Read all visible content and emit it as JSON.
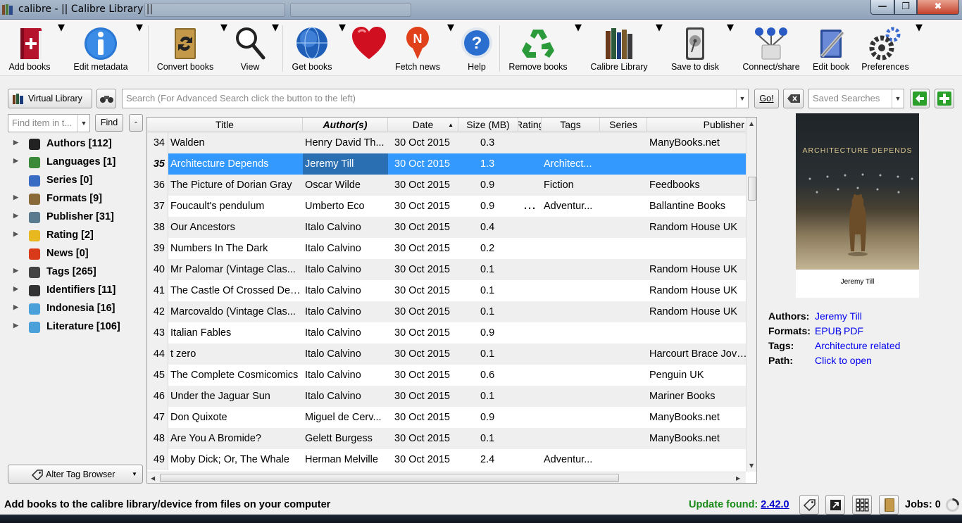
{
  "window": {
    "title": "calibre - || Calibre Library ||",
    "minimize_label": "—",
    "maximize_label": "❐",
    "close_label": "✖"
  },
  "toolbar": {
    "items": [
      {
        "label": "Add books",
        "icon": "add-book-icon"
      },
      {
        "label": "Edit metadata",
        "icon": "info-icon"
      },
      {
        "label": "Convert books",
        "icon": "convert-icon"
      },
      {
        "label": "View",
        "icon": "magnifier-icon"
      },
      {
        "label": "Get books",
        "icon": "globe-icon"
      },
      {
        "label": "Donate",
        "icon": "heart-icon"
      },
      {
        "label": "Fetch news",
        "icon": "news-icon"
      },
      {
        "label": "Help",
        "icon": "help-icon"
      },
      {
        "label": "Remove books",
        "icon": "recycle-icon"
      },
      {
        "label": "Calibre Library",
        "icon": "library-icon"
      },
      {
        "label": "Save to disk",
        "icon": "disk-icon"
      },
      {
        "label": "Connect/share",
        "icon": "network-icon"
      },
      {
        "label": "Edit book",
        "icon": "edit-book-icon"
      },
      {
        "label": "Preferences",
        "icon": "gear-icon"
      }
    ]
  },
  "search": {
    "virtual_library_label": "Virtual Library",
    "placeholder": "Search (For Advanced Search click the button to the left)",
    "go_label": "Go!",
    "saved_searches_placeholder": "Saved Searches"
  },
  "tag_browser": {
    "find_placeholder": "Find item in t...",
    "find_label": "Find",
    "collapse_label": "-",
    "alter_label": "Alter Tag Browser",
    "items": [
      {
        "label": "Authors [112]",
        "expandable": true,
        "icon": "person-icon",
        "color": "#222222"
      },
      {
        "label": "Languages [1]",
        "expandable": true,
        "icon": "languages-icon",
        "color": "#3a8a3a"
      },
      {
        "label": "Series [0]",
        "expandable": false,
        "icon": "series-icon",
        "color": "#3a6bc4"
      },
      {
        "label": "Formats [9]",
        "expandable": true,
        "icon": "book-icon",
        "color": "#8b6a3a"
      },
      {
        "label": "Publisher [31]",
        "expandable": true,
        "icon": "publisher-icon",
        "color": "#5a7a90"
      },
      {
        "label": "Rating [2]",
        "expandable": true,
        "icon": "star-icon",
        "color": "#e8b820"
      },
      {
        "label": "News [0]",
        "expandable": false,
        "icon": "news-icon",
        "color": "#d83a1a"
      },
      {
        "label": "Tags [265]",
        "expandable": true,
        "icon": "tag-icon",
        "color": "#444444"
      },
      {
        "label": "Identifiers [11]",
        "expandable": true,
        "icon": "barcode-icon",
        "color": "#333333"
      },
      {
        "label": "Indonesia [16]",
        "expandable": true,
        "icon": "folder-plus-icon",
        "color": "#4aa0d8"
      },
      {
        "label": "Literature [106]",
        "expandable": true,
        "icon": "folder-plus-icon",
        "color": "#4aa0d8"
      }
    ]
  },
  "table": {
    "columns": [
      "Title",
      "Author(s)",
      "Date",
      "Size (MB)",
      "Rating",
      "Tags",
      "Series",
      "Publisher"
    ],
    "rows": [
      {
        "num": "34",
        "title": "Walden",
        "author": "Henry David Th...",
        "date": "30 Oct 2015",
        "size": "0.3",
        "rating": "",
        "tags": "",
        "publisher": "ManyBooks.net"
      },
      {
        "num": "35",
        "title": "Architecture Depends",
        "author": "Jeremy Till",
        "date": "30 Oct 2015",
        "size": "1.3",
        "rating": "",
        "tags": "Architect...",
        "publisher": ""
      },
      {
        "num": "36",
        "title": "The Picture of Dorian Gray",
        "author": "Oscar Wilde",
        "date": "30 Oct 2015",
        "size": "0.9",
        "rating": "",
        "tags": "Fiction",
        "publisher": "Feedbooks"
      },
      {
        "num": "37",
        "title": "Foucault's pendulum",
        "author": "Umberto Eco",
        "date": "30 Oct 2015",
        "size": "0.9",
        "rating": "...",
        "tags": "Adventur...",
        "publisher": "Ballantine Books"
      },
      {
        "num": "38",
        "title": "Our Ancestors",
        "author": "Italo Calvino",
        "date": "30 Oct 2015",
        "size": "0.4",
        "rating": "",
        "tags": "",
        "publisher": "Random House UK"
      },
      {
        "num": "39",
        "title": "Numbers In The Dark",
        "author": "Italo Calvino",
        "date": "30 Oct 2015",
        "size": "0.2",
        "rating": "",
        "tags": "",
        "publisher": ""
      },
      {
        "num": "40",
        "title": "Mr Palomar (Vintage Clas...",
        "author": "Italo Calvino",
        "date": "30 Oct 2015",
        "size": "0.1",
        "rating": "",
        "tags": "",
        "publisher": "Random House UK"
      },
      {
        "num": "41",
        "title": "The Castle Of Crossed Des...",
        "author": "Italo Calvino",
        "date": "30 Oct 2015",
        "size": "0.1",
        "rating": "",
        "tags": "",
        "publisher": "Random House UK"
      },
      {
        "num": "42",
        "title": "Marcovaldo (Vintage Clas...",
        "author": "Italo Calvino",
        "date": "30 Oct 2015",
        "size": "0.1",
        "rating": "",
        "tags": "",
        "publisher": "Random House UK"
      },
      {
        "num": "43",
        "title": "Italian Fables",
        "author": "Italo Calvino",
        "date": "30 Oct 2015",
        "size": "0.9",
        "rating": "",
        "tags": "",
        "publisher": ""
      },
      {
        "num": "44",
        "title": "t zero",
        "author": "Italo Calvino",
        "date": "30 Oct 2015",
        "size": "0.1",
        "rating": "",
        "tags": "",
        "publisher": "Harcourt Brace Jovan"
      },
      {
        "num": "45",
        "title": "The Complete Cosmicomics",
        "author": "Italo Calvino",
        "date": "30 Oct 2015",
        "size": "0.6",
        "rating": "",
        "tags": "",
        "publisher": "Penguin UK"
      },
      {
        "num": "46",
        "title": "Under the Jaguar Sun",
        "author": "Italo Calvino",
        "date": "30 Oct 2015",
        "size": "0.1",
        "rating": "",
        "tags": "",
        "publisher": "Mariner Books"
      },
      {
        "num": "47",
        "title": "Don Quixote",
        "author": "Miguel de Cerv...",
        "date": "30 Oct 2015",
        "size": "0.9",
        "rating": "",
        "tags": "",
        "publisher": "ManyBooks.net"
      },
      {
        "num": "48",
        "title": "Are You A Bromide?",
        "author": "Gelett Burgess",
        "date": "30 Oct 2015",
        "size": "0.1",
        "rating": "",
        "tags": "",
        "publisher": "ManyBooks.net"
      },
      {
        "num": "49",
        "title": "Moby Dick; Or, The Whale",
        "author": "Herman Melville",
        "date": "30 Oct 2015",
        "size": "2.4",
        "rating": "",
        "tags": "Adventur...",
        "publisher": ""
      }
    ]
  },
  "details": {
    "cover_title": "ARCHITECTURE DEPENDS",
    "cover_author": "Jeremy Till",
    "authors_key": "Authors:",
    "authors_val": "Jeremy Till",
    "formats_key": "Formats:",
    "format_1": "EPUB",
    "format_sep": ",",
    "format_2": "PDF",
    "tags_key": "Tags:",
    "tags_val": "Architecture related",
    "path_key": "Path:",
    "path_val": "Click to open"
  },
  "status": {
    "message": "Add books to the calibre library/device from files on your computer",
    "update_label": "Update found:",
    "update_version": "2.42.0",
    "jobs_label": "Jobs: 0"
  }
}
